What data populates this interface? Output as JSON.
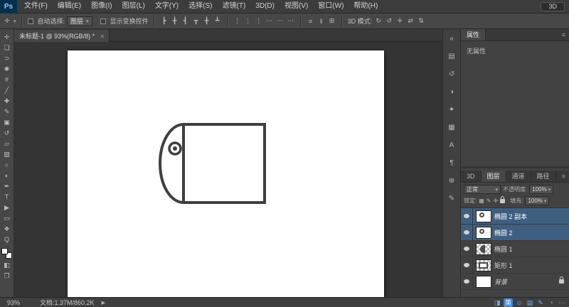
{
  "menu": {
    "logo": "Ps",
    "items": [
      "文件(F)",
      "编辑(E)",
      "图像(I)",
      "图层(L)",
      "文字(Y)",
      "选择(S)",
      "滤镜(T)",
      "3D(D)",
      "视图(V)",
      "窗口(W)",
      "帮助(H)"
    ],
    "workspace": "3D"
  },
  "ui": {
    "dd_arrow": "▾",
    "panel_menu": "≡"
  },
  "options": {
    "tool_glyph": "✛",
    "auto_select_label": "自动选择:",
    "auto_select_value": "图层",
    "show_transform_label": "显示变换控件",
    "align_icons": [
      {
        "name": "align-left",
        "glyph": "┣"
      },
      {
        "name": "align-center-h",
        "glyph": "╋"
      },
      {
        "name": "align-right",
        "glyph": "┫"
      },
      {
        "name": "align-top",
        "glyph": "┳"
      },
      {
        "name": "align-middle",
        "glyph": "╋"
      },
      {
        "name": "align-bottom",
        "glyph": "┻"
      }
    ],
    "distribute_icons": [
      {
        "name": "distribute-top",
        "glyph": "⋮"
      },
      {
        "name": "distribute-middle",
        "glyph": "⋮"
      },
      {
        "name": "distribute-bottom",
        "glyph": "⋮"
      },
      {
        "name": "distribute-left",
        "glyph": "⋯"
      },
      {
        "name": "distribute-center",
        "glyph": "⋯"
      },
      {
        "name": "distribute-right",
        "glyph": "⋯"
      }
    ],
    "spacing_icons": [
      {
        "name": "distribute-h-space",
        "glyph": "≡"
      },
      {
        "name": "distribute-v-space",
        "glyph": "‖"
      },
      {
        "name": "auto-align",
        "glyph": "⊞"
      }
    ],
    "mode_label": "3D 模式:",
    "mode_icons": [
      {
        "name": "3d-rotate",
        "glyph": "↻"
      },
      {
        "name": "3d-roll",
        "glyph": "↺"
      },
      {
        "name": "3d-pan",
        "glyph": "✛"
      },
      {
        "name": "3d-slide",
        "glyph": "⇄"
      },
      {
        "name": "3d-scale",
        "glyph": "⇅"
      }
    ]
  },
  "document": {
    "tab_title": "未标题-1 @ 93%(RGB/8) *",
    "close_glyph": "×"
  },
  "tools": [
    {
      "name": "move",
      "glyph": "✛"
    },
    {
      "name": "marquee",
      "glyph": "❏"
    },
    {
      "name": "lasso",
      "glyph": "⊃"
    },
    {
      "name": "quick-select",
      "glyph": "✱"
    },
    {
      "name": "crop",
      "glyph": "#"
    },
    {
      "name": "eyedropper",
      "glyph": "╱"
    },
    {
      "name": "healing-brush",
      "glyph": "✚"
    },
    {
      "name": "brush",
      "glyph": "✎"
    },
    {
      "name": "clone-stamp",
      "glyph": "▣"
    },
    {
      "name": "history-brush",
      "glyph": "↺"
    },
    {
      "name": "eraser",
      "glyph": "▱"
    },
    {
      "name": "gradient",
      "glyph": "▨"
    },
    {
      "name": "blur",
      "glyph": "○"
    },
    {
      "name": "dodge",
      "glyph": "◐"
    },
    {
      "name": "pen",
      "glyph": "✒"
    },
    {
      "name": "type",
      "glyph": "T"
    },
    {
      "name": "path-select",
      "glyph": "▶"
    },
    {
      "name": "shape",
      "glyph": "▭"
    },
    {
      "name": "hand",
      "glyph": "❖"
    },
    {
      "name": "zoom",
      "glyph": "Q"
    }
  ],
  "tools_bottom": [
    {
      "name": "quick-mask",
      "glyph": "◧"
    },
    {
      "name": "screen-mode",
      "glyph": "❐"
    }
  ],
  "right_strip": [
    {
      "name": "collapse-panels",
      "glyph": "«"
    },
    {
      "name": "swatches",
      "glyph": "▤"
    },
    {
      "name": "history",
      "glyph": "↺"
    },
    {
      "name": "adjustments",
      "glyph": "◑"
    },
    {
      "name": "styles",
      "glyph": "✦"
    },
    {
      "name": "color",
      "glyph": "▦"
    },
    {
      "name": "character",
      "glyph": "A"
    },
    {
      "name": "paragraph",
      "glyph": "¶"
    },
    {
      "name": "clone-source",
      "glyph": "⊕"
    },
    {
      "name": "notes",
      "glyph": "✎"
    }
  ],
  "properties": {
    "tab": "属性",
    "empty_text": "无属性"
  },
  "layers": {
    "tabs": [
      "3D",
      "图层",
      "通道",
      "路径"
    ],
    "blend_mode": "正常",
    "opacity_label": "不透明度:",
    "opacity_value": "100%",
    "lock_label": "锁定:",
    "lock_icons": [
      {
        "name": "lock-transparent",
        "glyph": "▦"
      },
      {
        "name": "lock-pixels",
        "glyph": "✎"
      },
      {
        "name": "lock-position",
        "glyph": "✛"
      }
    ],
    "fill_label": "填充:",
    "fill_value": "100%",
    "rows": [
      {
        "name": "椭圆 2 副本",
        "selected": true
      },
      {
        "name": "椭圆 2",
        "selected": true
      },
      {
        "name": "椭圆 1",
        "selected": false
      },
      {
        "name": "矩形 1",
        "selected": false
      },
      {
        "name": "背景",
        "selected": false,
        "locked": true
      }
    ]
  },
  "status": {
    "zoom": "93%",
    "doc_info": "文档:1.37M/860.2K",
    "expand_glyph": "▶"
  },
  "taskbar_icons": [
    {
      "name": "ime-logo",
      "glyph": "◨"
    },
    {
      "name": "ime-lang",
      "glyph": "英"
    },
    {
      "name": "ime-emoji",
      "glyph": "☺"
    },
    {
      "name": "ime-keyboard",
      "glyph": "▤"
    },
    {
      "name": "ime-pen",
      "glyph": "✎"
    },
    {
      "name": "ime-skin",
      "glyph": "◔"
    },
    {
      "name": "ime-more",
      "glyph": "⋯"
    }
  ],
  "colors": {
    "selected_layer": "#3e5f80",
    "shape_stroke": "#3f3f3f",
    "ime_blue": "#3b87d9"
  }
}
